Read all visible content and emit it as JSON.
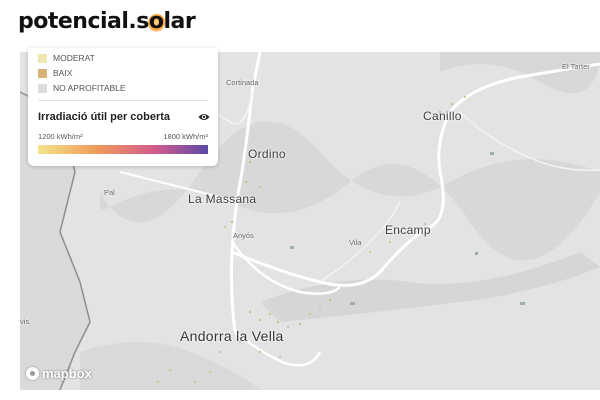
{
  "brand": {
    "logo_prefix": "potencial.s",
    "logo_o": "o",
    "logo_suffix": "lar"
  },
  "legend": {
    "categories": [
      {
        "label": "MODERAT",
        "color": "#f0e6b4"
      },
      {
        "label": "BAIX",
        "color": "#d8b07a"
      },
      {
        "label": "NO APROFITABLE",
        "color": "#dcdcdc"
      }
    ],
    "title": "Irradiació útil per coberta",
    "range_min": "1200 kWh/m²",
    "range_max": "1800 kWh/m²",
    "gradient_colors": [
      "#f4e38a",
      "#ee9a5a",
      "#d45c8c",
      "#5b48a6"
    ]
  },
  "map": {
    "places": {
      "ordino": "Ordino",
      "la_massana": "La Massana",
      "encamp": "Encamp",
      "canillo": "Canillo",
      "andorra_la_vella": "Andorra la Vella",
      "pal": "Pal",
      "anyos": "Anyós",
      "vila": "Vila",
      "cortinada": "Cortinada",
      "el_tarter": "El Tarter",
      "avis": "vis"
    },
    "attribution": "mapbox"
  }
}
